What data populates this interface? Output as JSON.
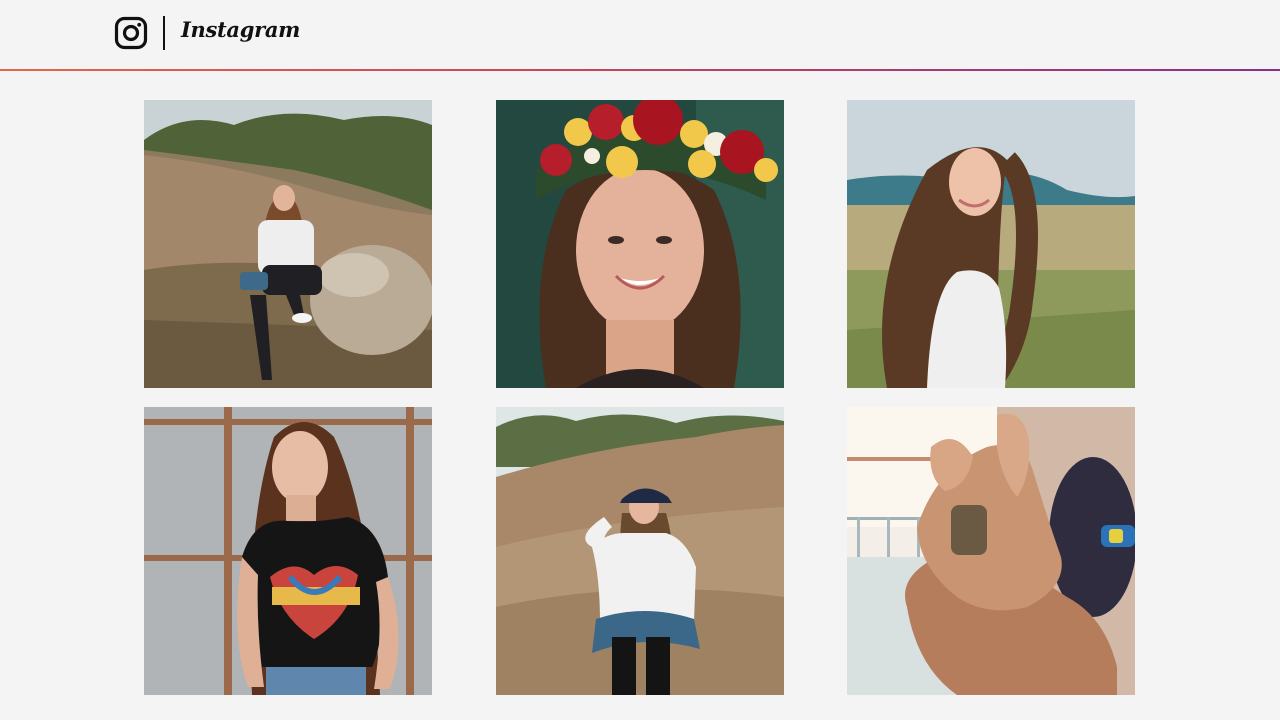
{
  "header": {
    "brand_name": "Instagram",
    "logo_icon": "instagram-icon"
  },
  "colors": {
    "background": "#f4f4f4",
    "accent_gradient": [
      "#e0684a",
      "#c2465c",
      "#8e2e8a"
    ]
  },
  "posts": [
    {
      "subject": "woman-sitting-on-rock"
    },
    {
      "subject": "woman-with-flower-crown"
    },
    {
      "subject": "woman-in-field"
    },
    {
      "subject": "woman-in-band-tshirt"
    },
    {
      "subject": "woman-in-cap-on-dirt-hill"
    },
    {
      "subject": "holding-hands-closeup"
    }
  ]
}
